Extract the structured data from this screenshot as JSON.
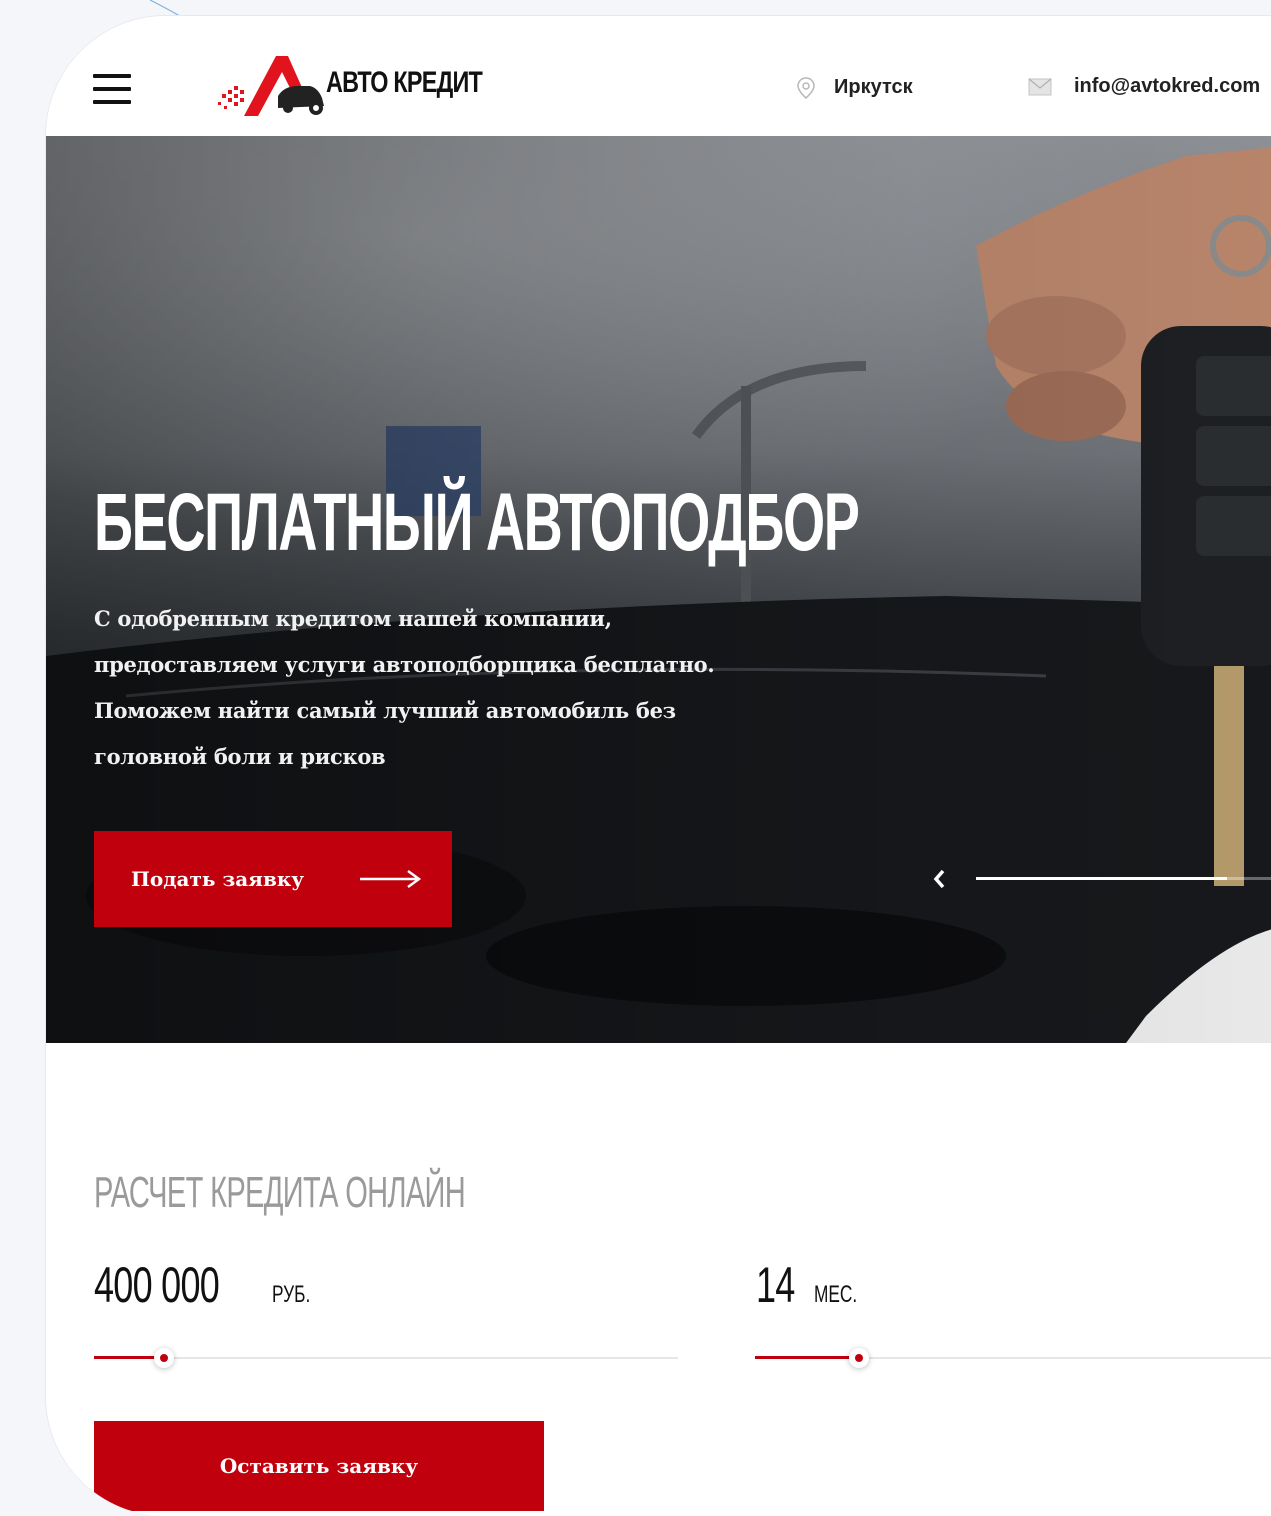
{
  "header": {
    "brand": "АВТО КРЕДИТ",
    "city": "Иркутск",
    "email": "info@avtokred.com",
    "icons": {
      "menu": "hamburger-icon",
      "city": "location-pin-icon",
      "email": "envelope-icon"
    }
  },
  "hero": {
    "title": "БЕСПЛАТНЫЙ АВТОПОДБОР",
    "text_lines": [
      "С одобренным кредитом нашей компании,",
      "предоставляем услуги автоподборщика бесплатно.",
      "Поможем найти самый лучший автомобиль без",
      "головной боли и рисков"
    ],
    "cta_label": "Подать заявку",
    "slider_progress": 0.81
  },
  "calculator": {
    "title": "РАСЧЕТ КРЕДИТА ОНЛАЙН",
    "amount": {
      "value": "400 000",
      "unit": "РУБ.",
      "fill": 0.12
    },
    "term": {
      "value": "14",
      "unit": "МЕС.",
      "fill": 0.195
    },
    "submit_label": "Оставить заявку"
  },
  "colors": {
    "accent": "#c0000c",
    "muted_heading": "#9a9a9a",
    "text": "#111111"
  }
}
